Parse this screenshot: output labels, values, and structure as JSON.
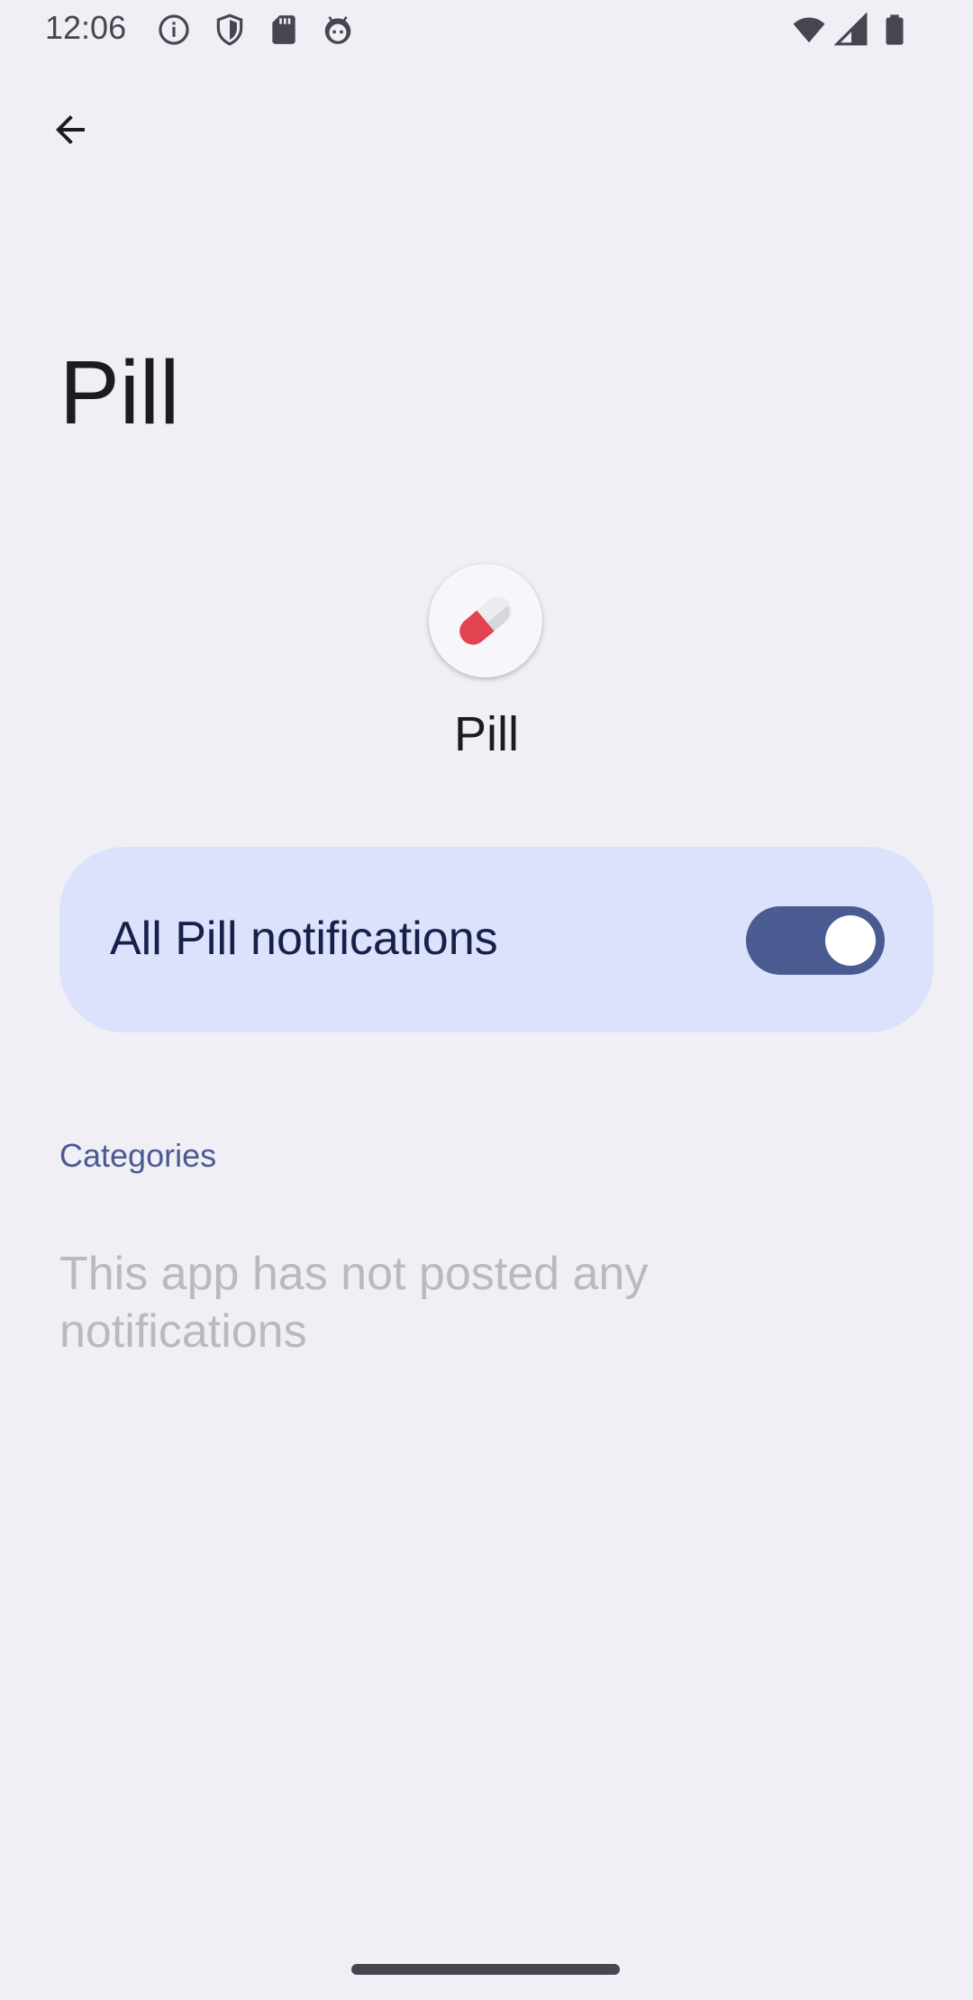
{
  "status_bar": {
    "time": "12:06",
    "left_icons": [
      "info-icon",
      "shield-icon",
      "sd-card-icon",
      "android-head-icon"
    ],
    "right_icons": [
      "wifi-icon",
      "signal-icon",
      "battery-icon"
    ]
  },
  "header": {
    "back_icon": "arrow-left-icon",
    "title": "Pill"
  },
  "app": {
    "name": "Pill",
    "icon": "pill-icon"
  },
  "master_toggle": {
    "label": "All Pill notifications",
    "checked": true
  },
  "categories": {
    "header": "Categories",
    "empty_message": "This app has not posted any notifications"
  },
  "colors": {
    "background": "#f0eff6",
    "card": "#dce1fc",
    "accent": "#4a5b92",
    "pill_red": "#e2444f"
  }
}
